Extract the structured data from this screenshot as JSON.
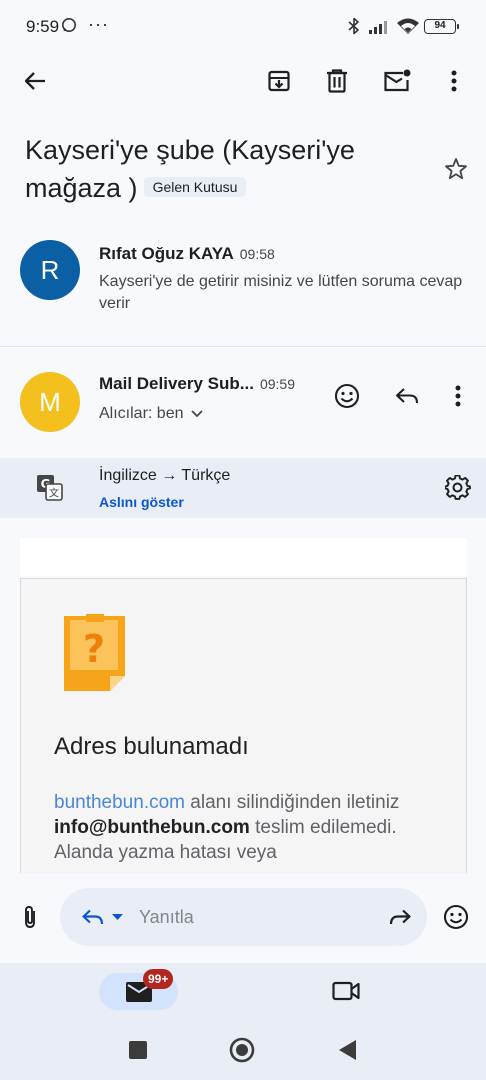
{
  "status_bar": {
    "time": "9:59",
    "overflow": "···",
    "battery": "94"
  },
  "toolbar": {
    "back_icon": "arrow-left-icon",
    "archive_icon": "archive-icon",
    "delete_icon": "trash-icon",
    "mark_unread_icon": "mail-unread-icon",
    "more_icon": "more-vert-icon"
  },
  "thread": {
    "subject": "Kayseri'ye şube  (Kayseri'ye mağaza )",
    "label": "Gelen Kutusu",
    "star_icon": "star-outline-icon"
  },
  "messages": [
    {
      "avatar_letter": "R",
      "avatar_color": "#0b5fa5",
      "sender": "Rıfat Oğuz KAYA",
      "time": "09:58",
      "snippet": "Kayseri'ye de getirir misiniz ve lütfen soruma cevap verir"
    },
    {
      "avatar_letter": "M",
      "avatar_color": "#f4c01e",
      "sender": "Mail Delivery Sub...",
      "time": "09:59",
      "recipients": "Alıcılar: ben"
    }
  ],
  "translation": {
    "languages": "İngilizce → Türkçe",
    "show_original": "Aslını göster"
  },
  "bounce_card": {
    "title": "Adres bulunamadı",
    "domain_link": "bunthebun.com",
    "text_1": " alanı silindiğinden iletiniz ",
    "email": "info@bunthebun.com",
    "text_2": " teslim edilemedi. Alanda yazma hatası veya"
  },
  "reply_bar": {
    "placeholder": "Yanıtla"
  },
  "bottom_nav": {
    "badge": "99+"
  },
  "colors": {
    "accent": "#0b57d0",
    "surface": "#e9eef6",
    "badge": "#b3261e"
  }
}
